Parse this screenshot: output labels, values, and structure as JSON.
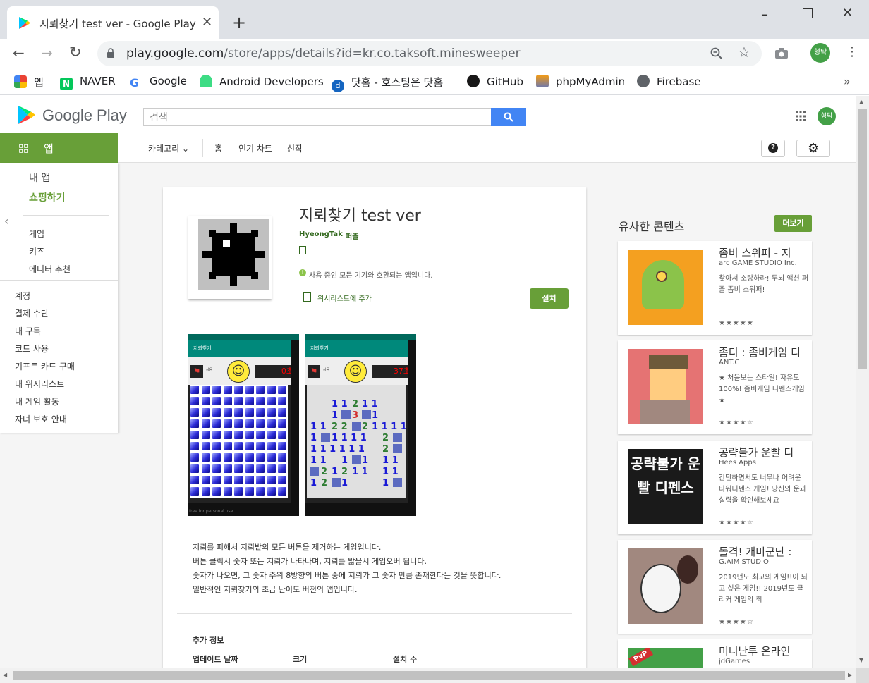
{
  "browser": {
    "tab_title": "지뢰찾기 test ver - Google Play",
    "url_host": "play.google.com",
    "url_path": "/store/apps/details?id=kr.co.taksoft.minesweeper",
    "profile_initials": "형탁",
    "bookmarks": [
      "앱",
      "NAVER",
      "Google",
      "Android Developers",
      "닷홈 - 호스팅은 닷홈",
      "GitHub",
      "phpMyAdmin",
      "Firebase"
    ]
  },
  "play": {
    "logo_text": "Google Play",
    "search_placeholder": "검색",
    "profile_initials": "형탁",
    "apps_tab": "앱",
    "subnav": {
      "category": "카테고리",
      "home": "홈",
      "top_charts": "인기 차트",
      "new": "신작"
    },
    "sidenav": {
      "primary": [
        "내 앱",
        "쇼핑하기"
      ],
      "secondary": [
        "게임",
        "키즈",
        "에디터 추천"
      ],
      "account": [
        "계정",
        "결제 수단",
        "내 구독",
        "코드 사용",
        "기프트 카드 구매",
        "내 위시리스트",
        "내 게임 활동",
        "자녀 보호 안내"
      ]
    }
  },
  "app": {
    "title": "지뢰찾기 test ver",
    "developer": "HyeongTak",
    "category": "퍼즐",
    "compat_notice": "사용 중인 모든 기기와 호환되는 앱입니다.",
    "wishlist_label": "위시리스트에 추가",
    "install_label": "설치",
    "screenshot1": {
      "appbar": "지뢰찾기",
      "timer": "0초",
      "checkbox": "사용"
    },
    "screenshot2": {
      "appbar": "지뢰찾기",
      "timer": "37초",
      "checkbox": "사용"
    },
    "watermark": "free for personal use",
    "description": [
      "지뢰를 피해서 지뢰밭의 모든 버튼을 제거하는 게임입니다.",
      "버튼 클릭시 숫자 또는 지뢰가 나타나며, 지뢰를 밟을시 게임오버 됩니다.",
      "숫자가 나오면, 그 숫자 주위 8방향의 버튼 중에 지뢰가 그 숫자 만큼 존재한다는 것을 뜻합니다.",
      "일반적인 지뢰찾기의 초급 난이도 버전의 앱입니다."
    ],
    "additional_info_title": "추가 정보",
    "info_labels": [
      "업데이트 날짜",
      "크기",
      "설치 수"
    ]
  },
  "similar": {
    "title": "유사한 콘텐츠",
    "more_label": "더보기",
    "items": [
      {
        "name": "좀비 스위퍼 - 지",
        "dev": "arc GAME STUDIO Inc.",
        "desc": "찾아서 소탕하라! 두뇌 액션 퍼즐 좀비 스위퍼!",
        "rating": "★★★★★",
        "color": "#f4a020"
      },
      {
        "name": "좀디 : 좀비게임 디",
        "dev": "ANT.C",
        "desc": "★ 처음보는 스타일! 자유도 100%! 좀비게임 디펜스게임 ★",
        "rating": "★★★★☆",
        "color": "#e57373"
      },
      {
        "name": "공략불가 운빨 디",
        "dev": "Hees Apps",
        "desc": "간단하면서도 너무나 어려운 타워디펜스 게임! 당신의 운과 실력을 확인해보세요",
        "rating": "★★★★☆",
        "color": "#1a1a1a",
        "art_text": "공략불가 운빨 디펜스"
      },
      {
        "name": "돌격! 개미군단 :",
        "dev": "G.AIM STUDIO",
        "desc": "2019년도 최고의 게임!!이 되고 싶은 게임!! 2019년도 클리커 게임의 최",
        "rating": "★★★★☆",
        "color": "#a1887f"
      },
      {
        "name": "미니난투 온라인",
        "dev": "jdGames",
        "desc": "",
        "rating": "",
        "color": "#43a047",
        "art_text": "PvP"
      }
    ]
  },
  "colors": {
    "play_green": "#689f38",
    "search_blue": "#4285f4"
  }
}
